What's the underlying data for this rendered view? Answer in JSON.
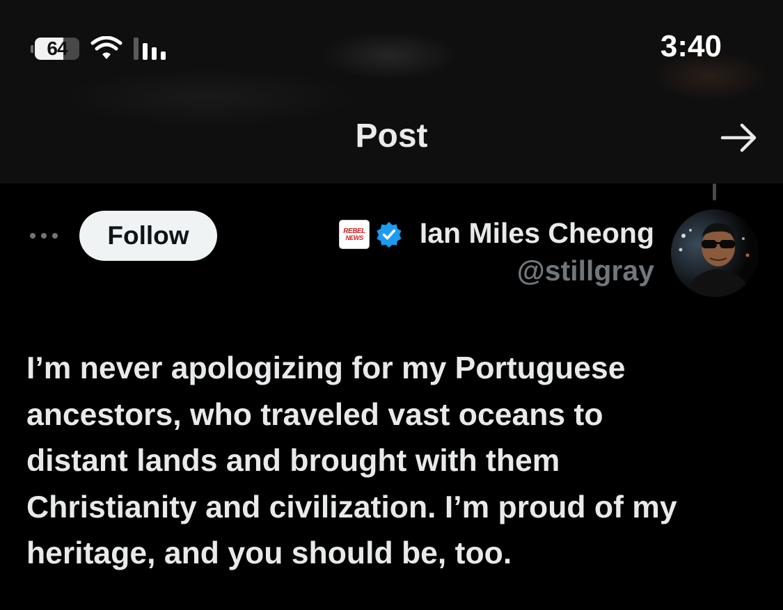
{
  "status_bar": {
    "battery_percent": 64,
    "battery_label": "64",
    "time": "3:40",
    "icons": [
      "battery-icon",
      "wifi-icon",
      "cellular-signal-icon"
    ]
  },
  "nav": {
    "title": "Post",
    "forward_icon": "arrow-right-icon"
  },
  "post": {
    "author": {
      "display_name": "Ian Miles Cheong",
      "handle": "@stillgray",
      "verified": true,
      "affiliate_badge": {
        "line1": "REBEL",
        "line2": "NEWS"
      },
      "avatar_icon": "avatar"
    },
    "follow_label": "Follow",
    "more_icon": "more-options-icon",
    "text_lines": [
      "I’m never apologizing for my Portuguese",
      "ancestors, who traveled vast oceans to",
      "distant lands and brought with them",
      "Christianity and civilization. I’m proud of my",
      "heritage, and you should be, too."
    ]
  },
  "colors": {
    "background": "#000000",
    "header_background": "#0f0f0f",
    "primary_text": "#e7e9ea",
    "secondary_text": "#71767b",
    "follow_button_bg": "#eff3f4",
    "follow_button_text": "#0f1419",
    "verified_blue": "#1d9bf0"
  }
}
